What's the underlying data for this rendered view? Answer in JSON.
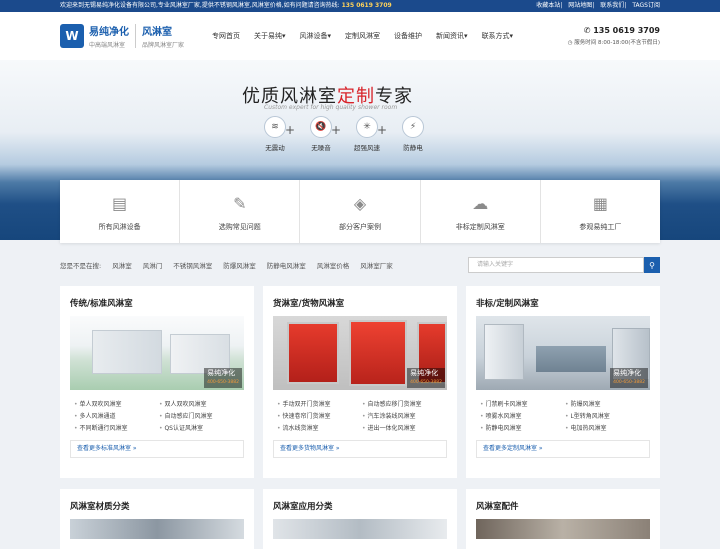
{
  "topbar": {
    "welcome": "欢迎来到无锡易纯净化设备有限公司,专业风淋室厂家,提供不锈钢风淋室,风淋室价格,如有问题请",
    "hotline_label": "咨询热线:",
    "hotline": "135 0619 3709",
    "links": [
      "收藏本站",
      "网站地图",
      "联系我们",
      "TAGS订阅"
    ]
  },
  "header": {
    "logo_name": "易纯净化",
    "logo_sub": "中高端风淋室",
    "logo2_name": "风淋室",
    "logo2_sub": "品牌风淋室厂家",
    "nav": [
      "专网首页",
      "关于易纯▾",
      "风淋设备▾",
      "定制风淋室",
      "设备维护",
      "新闻资讯▾",
      "联系方式▾"
    ],
    "phone": "✆ 135 0619 3709",
    "hours": "◷ 服务时间 8:00-18:00(不含节假日)"
  },
  "banner": {
    "slogan_a": "优质风淋室",
    "slogan_b": "定制",
    "slogan_c": "专家",
    "slogan_en": "Custom expert for high quality shower room",
    "features": [
      {
        "icon": "≋",
        "label": "无震动"
      },
      {
        "icon": "🔇",
        "label": "无噪音"
      },
      {
        "icon": "✳",
        "label": "超强风速"
      },
      {
        "icon": "⚡",
        "label": "防静电"
      }
    ]
  },
  "quick": [
    {
      "icon": "▤",
      "label": "所有风淋设备"
    },
    {
      "icon": "✎",
      "label": "选购常见问题"
    },
    {
      "icon": "◈",
      "label": "部分客户案例"
    },
    {
      "icon": "☁",
      "label": "非标定制风淋室"
    },
    {
      "icon": "▦",
      "label": "参观易纯工厂"
    }
  ],
  "crumb": {
    "label": "您是不是在搜:",
    "items": [
      "风淋室",
      "风淋门",
      "不锈钢风淋室",
      "防爆风淋室",
      "防静电风淋室",
      "风淋室价格",
      "风淋室厂家"
    ],
    "search_placeholder": "请输入关键字"
  },
  "watermark": {
    "name": "易纯净化",
    "tel": "400-650-3882"
  },
  "cards": [
    {
      "title": "传统/标准风淋室",
      "items": [
        "单人双吹风淋室",
        "双人双吹风淋室",
        "多人风淋通道",
        "自动感应门风淋室",
        "不同断通行风淋室",
        "QS认证风淋室"
      ],
      "more": "查看更多标准风淋室 »",
      "img": "standard"
    },
    {
      "title": "货淋室/货物风淋室",
      "items": [
        "手动双开门货淋室",
        "自动感应移门货淋室",
        "快速卷帘门货淋室",
        "汽车涂装线风淋室",
        "流水线货淋室",
        "进出一体化风淋室"
      ],
      "more": "查看更多货物风淋室 »",
      "img": "cargo"
    },
    {
      "title": "非标/定制风淋室",
      "items": [
        "门禁刷卡风淋室",
        "防爆风淋室",
        "喷雾水风淋室",
        "L型转角风淋室",
        "防静电风淋室",
        "电加热风淋室"
      ],
      "more": "查看更多定制风淋室 »",
      "img": "custom"
    }
  ],
  "cards2": [
    "风淋室材质分类",
    "风淋室应用分类",
    "风淋室配件"
  ]
}
